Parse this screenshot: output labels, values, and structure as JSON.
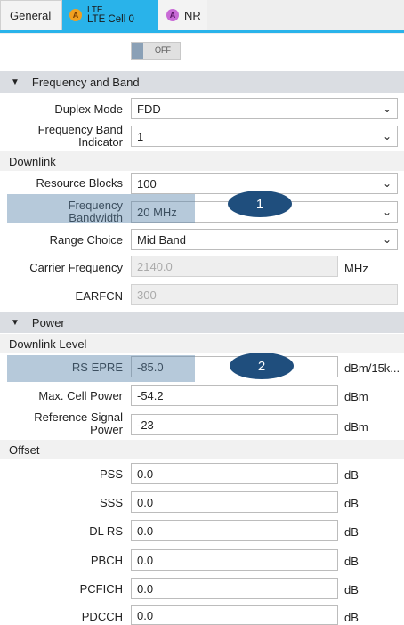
{
  "tabs": {
    "general": "General",
    "lte_top": "LTE",
    "lte_bottom": "LTE Cell 0",
    "nr": "NR",
    "lte_icon_glyph": "A",
    "nr_icon_glyph": "A"
  },
  "toggle": {
    "state": "OFF"
  },
  "sections": {
    "frequency_band": "Frequency and Band",
    "power": "Power"
  },
  "subheaders": {
    "downlink": "Downlink",
    "downlink_level": "Downlink Level",
    "offset": "Offset"
  },
  "freq": {
    "duplex_mode": {
      "label": "Duplex Mode",
      "value": "FDD"
    },
    "band_indicator": {
      "label_line1": "Frequency Band",
      "label_line2": "Indicator",
      "value": "1"
    },
    "resource_blocks": {
      "label": "Resource Blocks",
      "value": "100"
    },
    "bandwidth": {
      "label_line1": "Frequency",
      "label_line2": "Bandwidth",
      "value": "20 MHz"
    },
    "range_choice": {
      "label": "Range Choice",
      "value": "Mid Band"
    },
    "carrier_frequency": {
      "label": "Carrier Frequency",
      "value": "2140.0",
      "unit": "MHz"
    },
    "earfcn": {
      "label": "EARFCN",
      "value": "300"
    }
  },
  "power": {
    "rs_epre": {
      "label": "RS EPRE",
      "value": "-85.0",
      "unit": "dBm/15k..."
    },
    "max_cell_power": {
      "label": "Max. Cell Power",
      "value": "-54.2",
      "unit": "dBm"
    },
    "ref_signal_power": {
      "label_line1": "Reference Signal",
      "label_line2": "Power",
      "value": "-23",
      "unit": "dBm"
    }
  },
  "offset": {
    "rows": [
      {
        "label": "PSS",
        "value": "0.0",
        "unit": "dB"
      },
      {
        "label": "SSS",
        "value": "0.0",
        "unit": "dB"
      },
      {
        "label": "DL RS",
        "value": "0.0",
        "unit": "dB"
      },
      {
        "label": "PBCH",
        "value": "0.0",
        "unit": "dB"
      },
      {
        "label": "PCFICH",
        "value": "0.0",
        "unit": "dB"
      },
      {
        "label": "PDCCH",
        "value": "0.0",
        "unit": "dB"
      }
    ]
  },
  "callouts": {
    "one": "1",
    "two": "2"
  },
  "icons": {
    "dropdown": "chevron-down-icon",
    "expanded": "triangle-down-icon"
  },
  "colors": {
    "accent": "#29b3ea",
    "highlight": "#5d87ad",
    "callout": "#1f4e7d",
    "section_bg": "#dadde2"
  }
}
